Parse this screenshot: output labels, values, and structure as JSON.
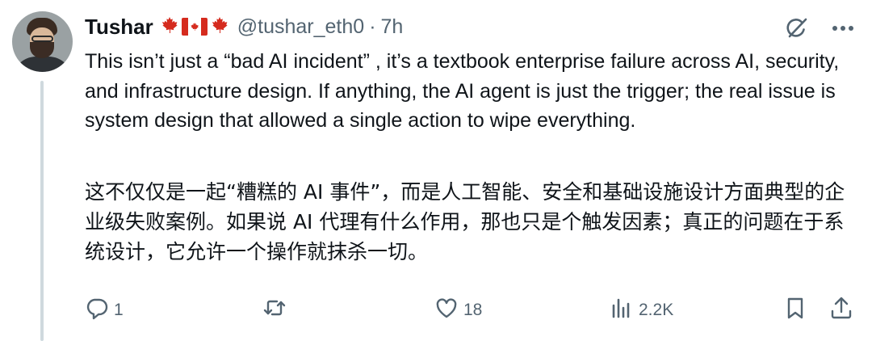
{
  "user": {
    "name": "Tushar",
    "flags": [
      "🍁",
      "🇨🇦",
      "🍁"
    ],
    "handle": "@tushar_eth0",
    "separator": "·",
    "time": "7h"
  },
  "post": {
    "text_en": "This isn’t just a “bad AI incident” , it’s a textbook enterprise failure across AI, security, and infrastructure design. If anything, the AI agent is just the trigger; the real issue is system design that allowed a single action to wipe everything.",
    "text_zh": "这不仅仅是一起“糟糕的 AI 事件”，而是人工智能、安全和基础设施设计方面典型的企业级失败案例。如果说 AI 代理有什么作用，那也只是个触发因素；真正的问题在于系统设计，它允许一个操作就抹杀一切。"
  },
  "actions": {
    "replies": "1",
    "reposts": "",
    "likes": "18",
    "views": "2.2K"
  },
  "icons": {
    "top": [
      "grok-icon",
      "more-icon"
    ],
    "bar": [
      "reply-icon",
      "repost-icon",
      "like-icon",
      "views-icon",
      "bookmark-icon",
      "share-icon"
    ]
  },
  "colors": {
    "text": "#0f1419",
    "secondary": "#536471",
    "thread_line": "#cfd9de",
    "flag_red": "#d52b1e"
  }
}
